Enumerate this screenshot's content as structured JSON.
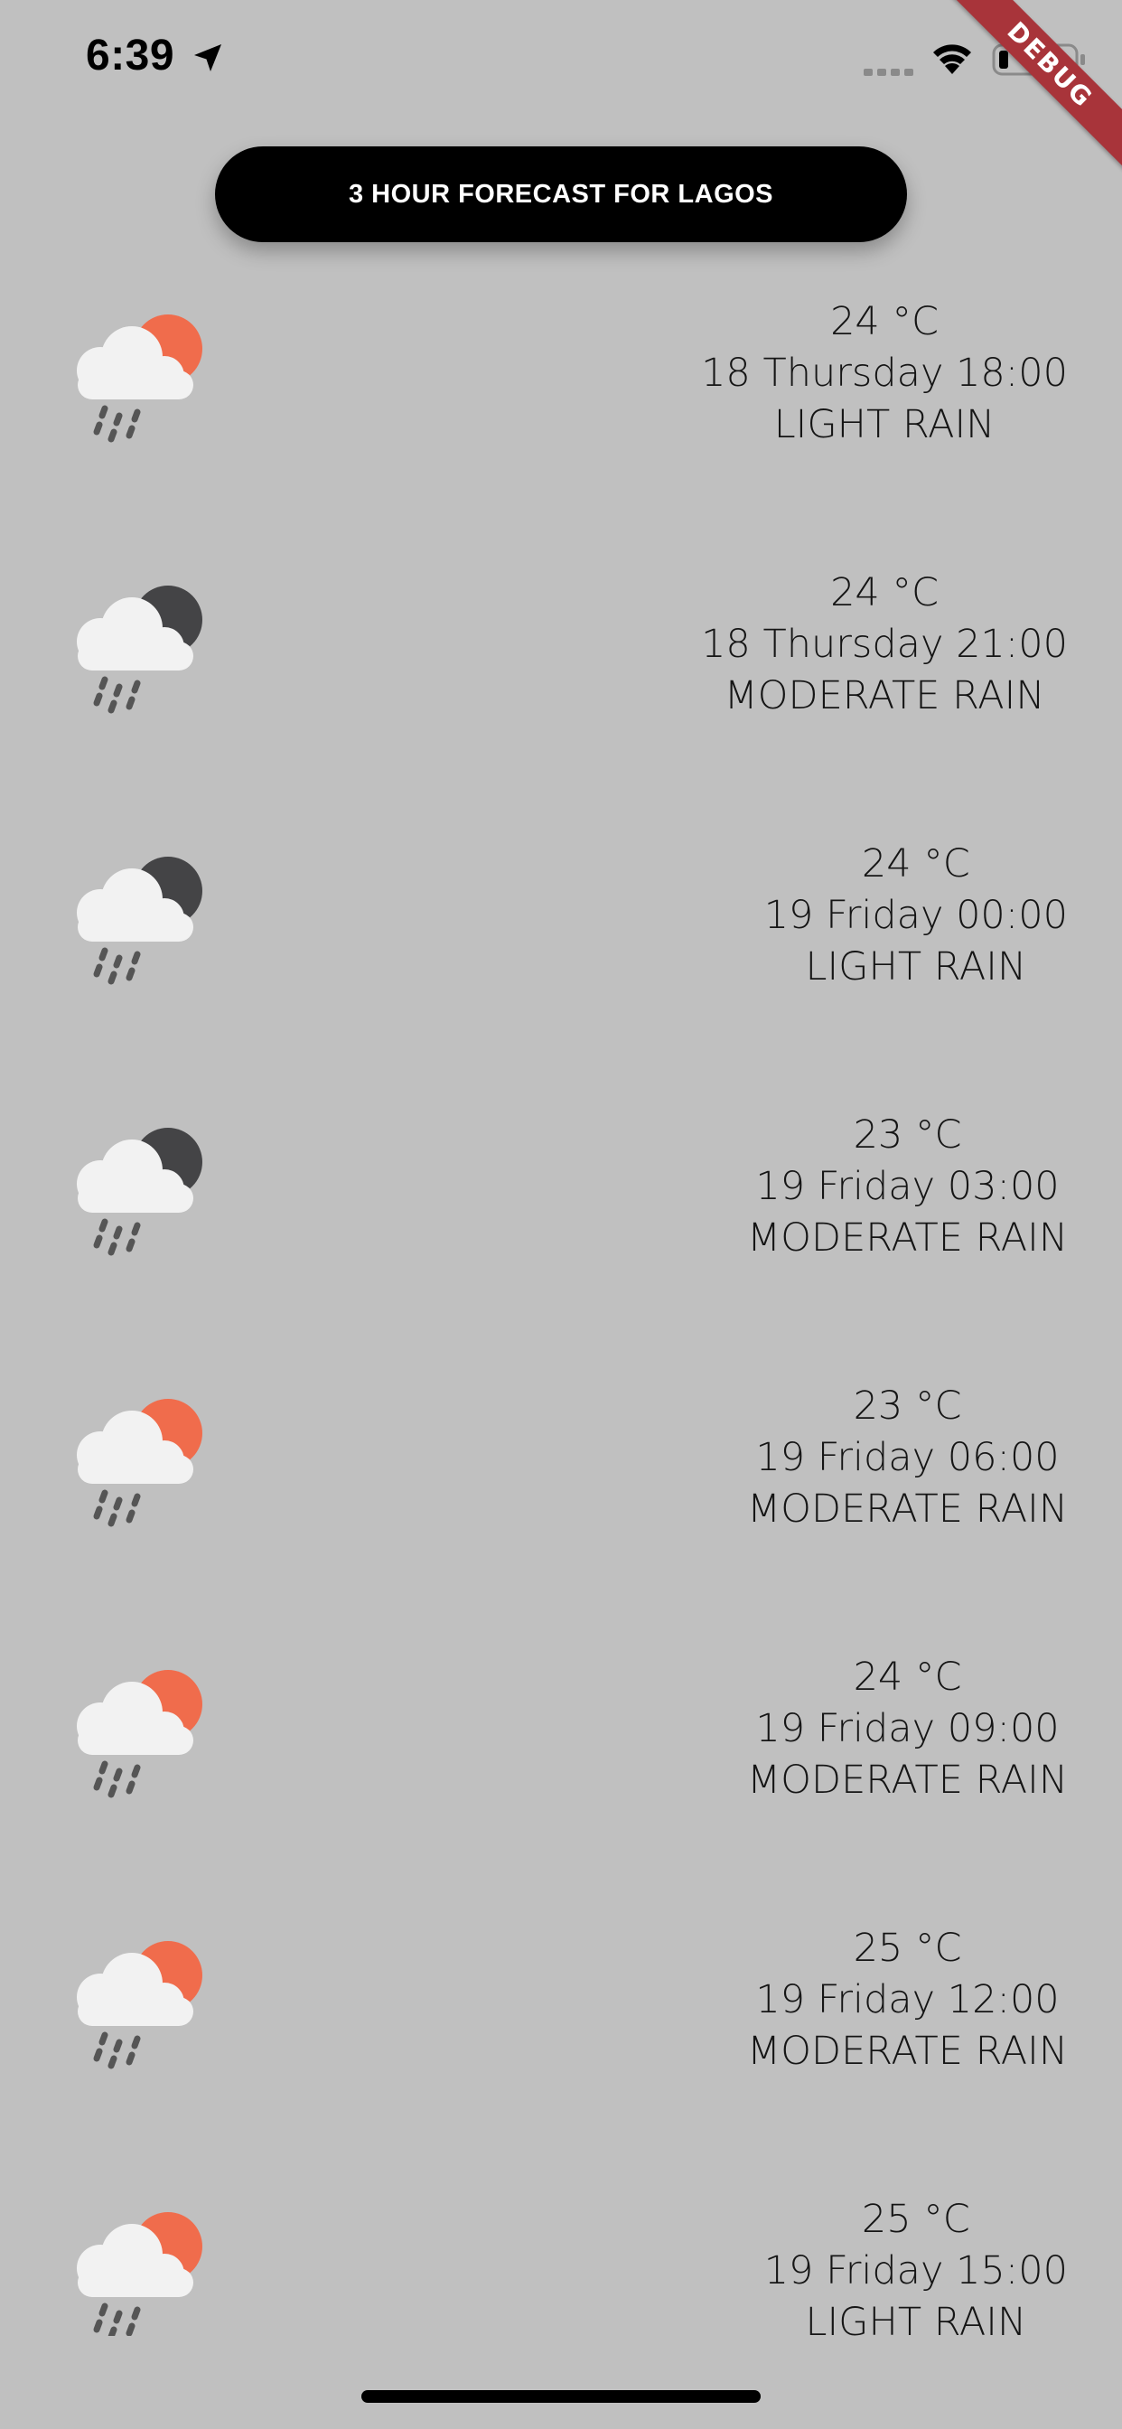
{
  "status_bar": {
    "time": "6:39",
    "icons": [
      "location-arrow-icon",
      "cellular-signal-icon",
      "wifi-icon",
      "battery-icon"
    ]
  },
  "debug_banner": "DEBUG",
  "header": {
    "title": "3 HOUR FORECAST FOR LAGOS",
    "background": "#000000"
  },
  "colors": {
    "background": "#c0c0c0",
    "sun": "#f06c4c",
    "moon": "#444446",
    "cloud": "#f2f2f2"
  },
  "forecast": [
    {
      "temp": "24 °C",
      "datetime": "18 Thursday 18:00",
      "description": "LIGHT RAIN",
      "icon": "cloud-sun-rain-icon"
    },
    {
      "temp": "24 °C",
      "datetime": "18 Thursday 21:00",
      "description": "MODERATE RAIN",
      "icon": "cloud-moon-rain-icon"
    },
    {
      "temp": "24 °C",
      "datetime": "19 Friday 00:00",
      "description": "LIGHT RAIN",
      "icon": "cloud-moon-rain-icon"
    },
    {
      "temp": "23 °C",
      "datetime": "19 Friday 03:00",
      "description": "MODERATE RAIN",
      "icon": "cloud-moon-rain-icon"
    },
    {
      "temp": "23 °C",
      "datetime": "19 Friday 06:00",
      "description": "MODERATE RAIN",
      "icon": "cloud-sun-rain-icon"
    },
    {
      "temp": "24 °C",
      "datetime": "19 Friday 09:00",
      "description": "MODERATE RAIN",
      "icon": "cloud-sun-rain-icon"
    },
    {
      "temp": "25 °C",
      "datetime": "19 Friday 12:00",
      "description": "MODERATE RAIN",
      "icon": "cloud-sun-rain-icon"
    },
    {
      "temp": "25 °C",
      "datetime": "19 Friday 15:00",
      "description": "LIGHT RAIN",
      "icon": "cloud-sun-rain-icon"
    }
  ]
}
